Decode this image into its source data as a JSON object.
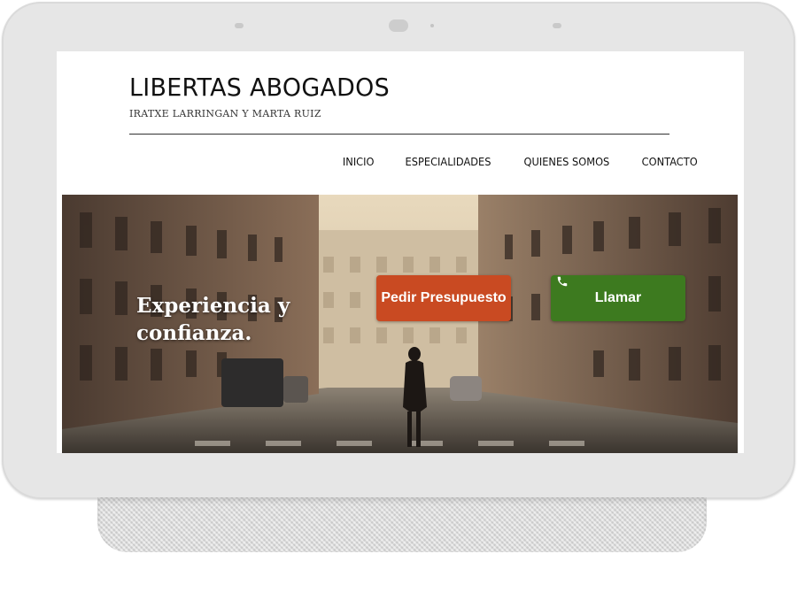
{
  "site": {
    "title": "LIBERTAS ABOGADOS",
    "subtitle": "IRATXE LARRINGAN Y MARTA RUIZ"
  },
  "nav": {
    "items": [
      {
        "label": "INICIO"
      },
      {
        "label": "ESPECIALIDADES"
      },
      {
        "label": "QUIENES SOMOS"
      },
      {
        "label": "CONTACTO"
      }
    ]
  },
  "hero": {
    "headline": "Experiencia y confianza.",
    "quote_button": "Pedir Presupuesto",
    "call_button": "Llamar",
    "call_icon": "phone-icon",
    "colors": {
      "quote_button": "#c94a22",
      "call_button": "#3d7a1f"
    }
  }
}
